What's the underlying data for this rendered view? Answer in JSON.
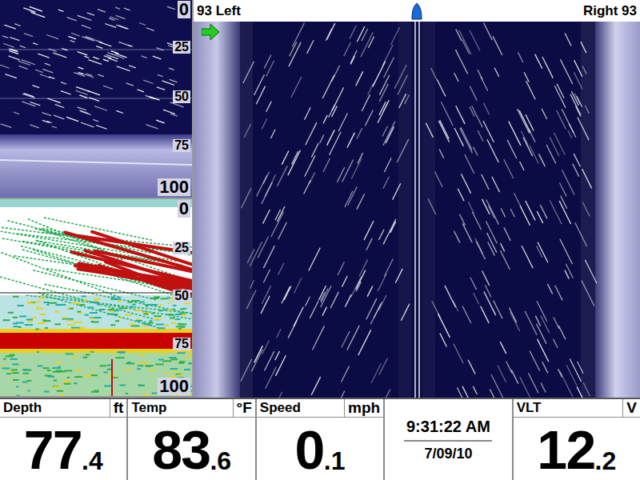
{
  "down_imaging": {
    "scale": [
      "0",
      "25",
      "50",
      "75",
      "100"
    ]
  },
  "sonar_2d": {
    "scale": [
      "0",
      "25",
      "50",
      "75",
      "100"
    ]
  },
  "side_imaging": {
    "left_label": "93 Left",
    "right_label": "Right 93"
  },
  "status_bar": [
    {
      "kind": "readout",
      "label": "Depth",
      "unit": "ft",
      "value": "77",
      "decimal": ".4"
    },
    {
      "kind": "readout",
      "label": "Temp",
      "unit": "°F",
      "value": "83",
      "decimal": ".6"
    },
    {
      "kind": "readout",
      "label": "Speed",
      "unit": "mph",
      "value": "0",
      "decimal": ".1"
    },
    {
      "kind": "clock",
      "time": "9:31:22 AM",
      "date": "7/09/10"
    },
    {
      "kind": "readout",
      "label": "VLT",
      "unit": "V",
      "value": "12",
      "decimal": ".2"
    }
  ]
}
